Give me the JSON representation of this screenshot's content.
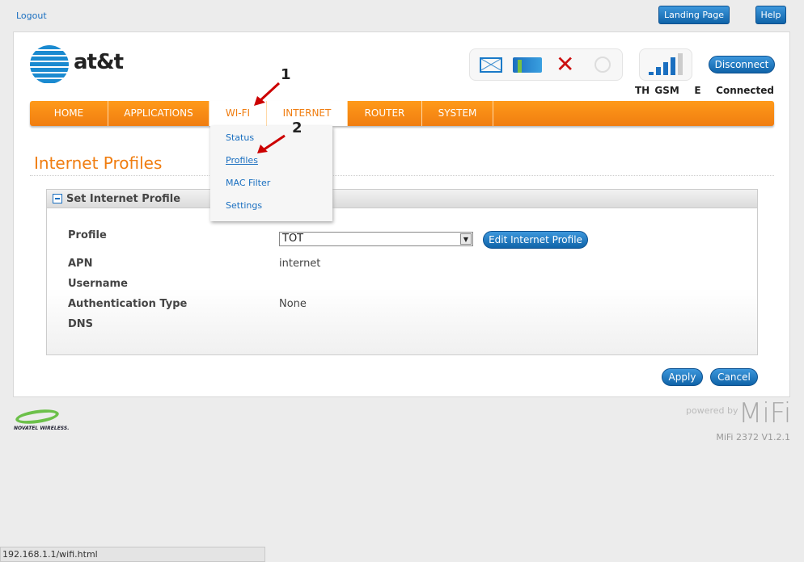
{
  "top": {
    "logout": "Logout",
    "landing_page": "Landing Page",
    "help": "Help"
  },
  "header": {
    "brand": "at&t",
    "disconnect": "Disconnect",
    "status": {
      "region": "TH GSM",
      "network_type": "E",
      "connection": "Connected"
    },
    "signal_bars": 4,
    "signal_bars_total": 5,
    "icons": [
      "mail-icon",
      "battery-charging-icon",
      "wifi-disabled-icon",
      "gps-icon"
    ]
  },
  "nav": {
    "items": [
      {
        "label": "HOME"
      },
      {
        "label": "APPLICATIONS"
      },
      {
        "label": "WI-FI"
      },
      {
        "label": "INTERNET"
      },
      {
        "label": "ROUTER"
      },
      {
        "label": "SYSTEM"
      }
    ],
    "dropdown": [
      {
        "label": "Status"
      },
      {
        "label": "Profiles"
      },
      {
        "label": "MAC Filter"
      },
      {
        "label": "Settings"
      }
    ]
  },
  "annotations": {
    "step1": "1",
    "step2": "2"
  },
  "page": {
    "title": "Internet Profiles",
    "section": "Set Internet Profile",
    "fields": {
      "profile_label": "Profile",
      "profile_value": "TOT",
      "edit_button": "Edit Internet Profile",
      "apn_label": "APN",
      "apn_value": "internet",
      "username_label": "Username",
      "username_value": "",
      "auth_label": "Authentication Type",
      "auth_value": "None",
      "dns_label": "DNS",
      "dns_value": ""
    },
    "apply": "Apply",
    "cancel": "Cancel"
  },
  "footer": {
    "vendor": "NOVATEL WIRELESS.",
    "powered_by": "powered by",
    "product_logo": "MiFi",
    "version": "MiFi 2372 V1.2.1"
  },
  "statusbar": {
    "url": "192.168.1.1/wifi.html"
  },
  "colors": {
    "accent": "#f07d10",
    "button": "#1a6fc0"
  }
}
